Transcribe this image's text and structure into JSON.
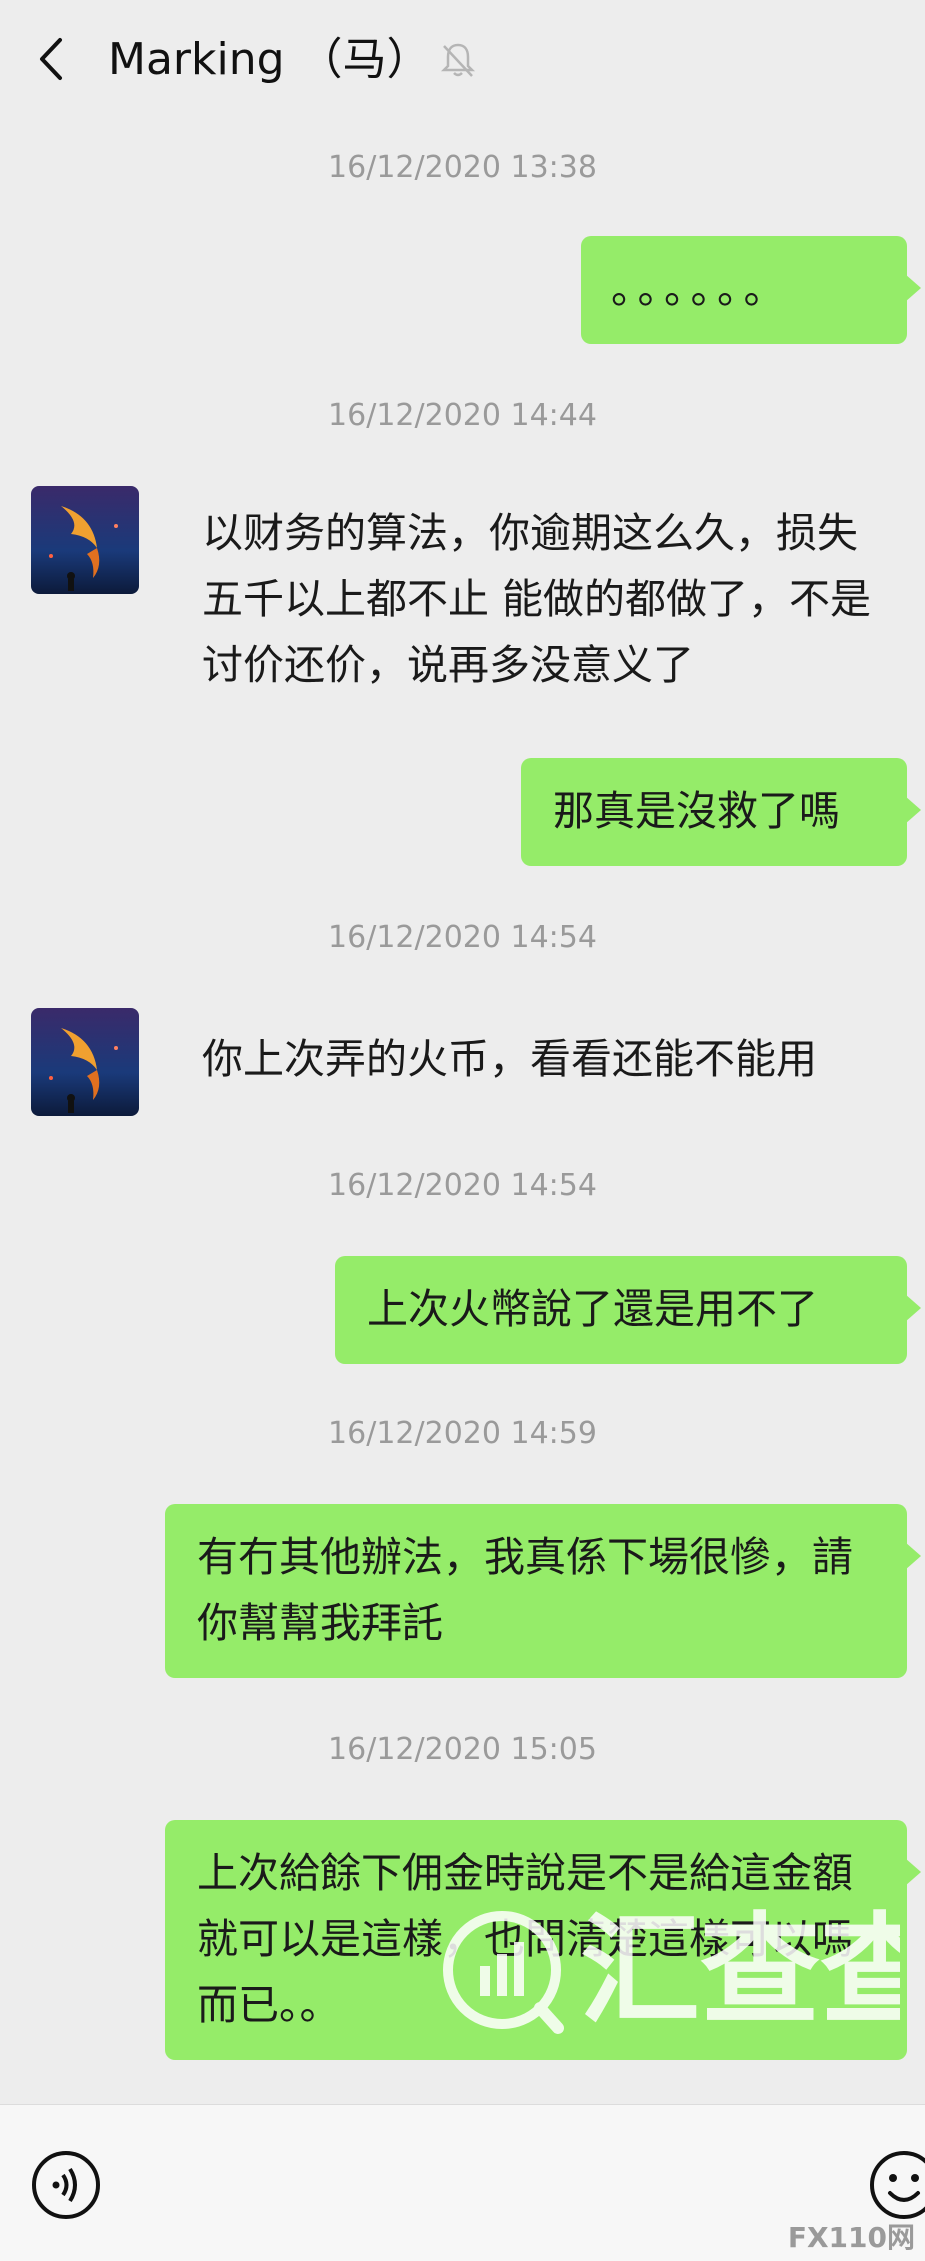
{
  "header": {
    "title": "Marking （马）"
  },
  "messages": {
    "ts1": "16/12/2020 13:38",
    "out1": "。。。。。。",
    "ts2": "16/12/2020 14:44",
    "in1": "以财务的算法，你逾期这么久，损失五千以上都不止 能做的都做了，不是讨价还价，说再多没意义了",
    "out2": "那真是沒救了嗎",
    "ts3": "16/12/2020 14:54",
    "in2": "你上次弄的火币，看看还能不能用",
    "ts4": "16/12/2020 14:54",
    "out3": "上次火幣說了還是用不了",
    "ts5": "16/12/2020 14:59",
    "out4": "有冇其他辦法，我真係下場很慘，請你幫幫我拜託",
    "ts6": "16/12/2020 15:05",
    "out5": "上次給餘下佣金時說是不是給這金額就可以是這樣，也問清楚這樣可以嗎而已。。"
  },
  "watermark": {
    "text": "汇查查"
  },
  "corner_logo": "FX110网",
  "colors": {
    "outgoing_bubble": "#95ec69",
    "background": "#ededed",
    "timestamp": "#9a9a9a"
  },
  "icons": {
    "back": "back-icon",
    "mute": "mute-icon",
    "voice": "voice-icon",
    "emoji": "emoji-icon",
    "avatar": "avatar"
  }
}
